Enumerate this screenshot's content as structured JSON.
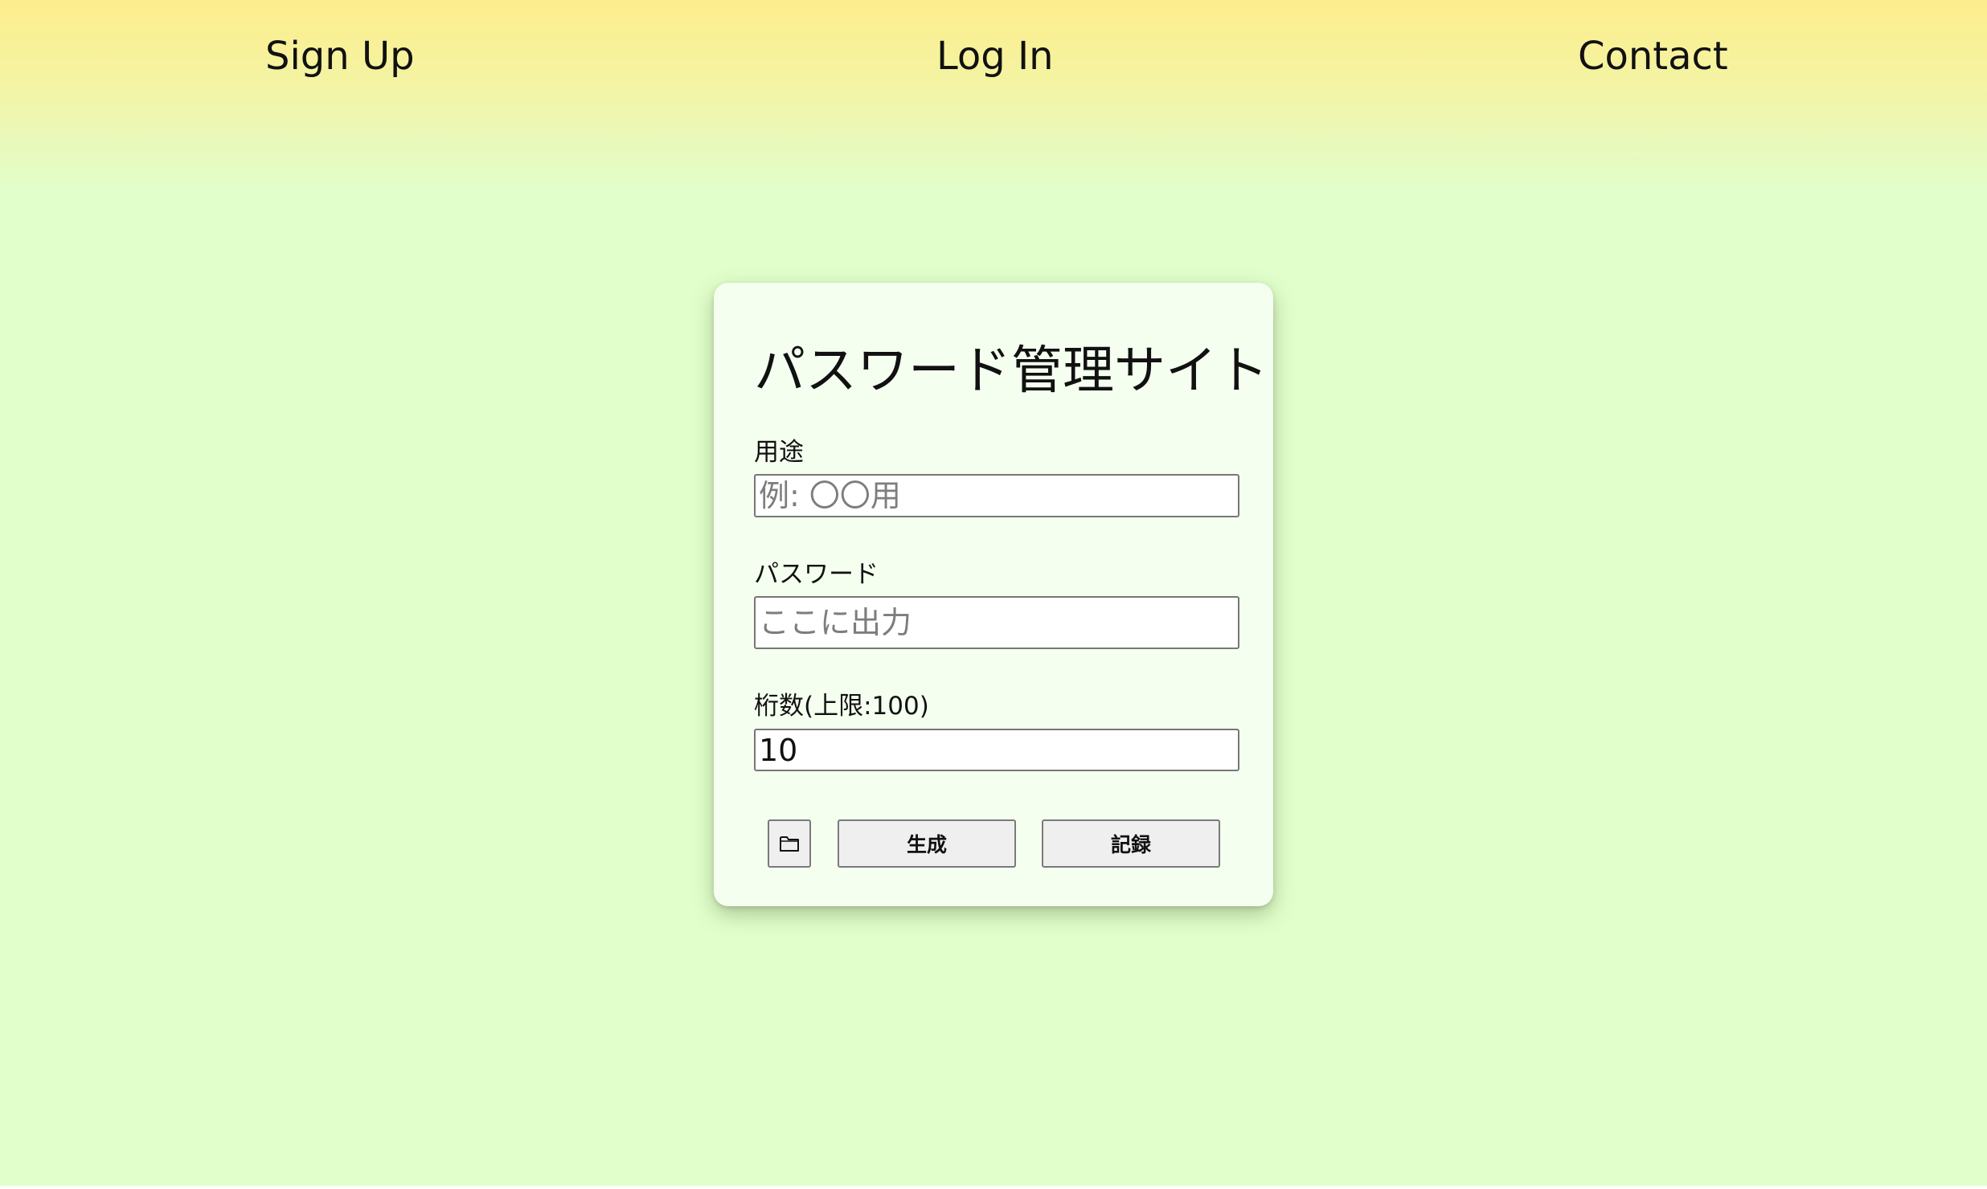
{
  "nav": {
    "items": [
      {
        "label": "Sign Up"
      },
      {
        "label": "Log In"
      },
      {
        "label": "Contact"
      }
    ]
  },
  "card": {
    "title": "パスワード管理サイト",
    "usage": {
      "label": "用途",
      "value": "",
      "placeholder": "例: 〇〇用"
    },
    "password": {
      "label": "パスワード",
      "value": "",
      "placeholder": "ここに出力"
    },
    "digits": {
      "label": "桁数(上限:100)",
      "value": "10"
    },
    "buttons": {
      "folder_icon": "folder-icon",
      "generate_label": "生成",
      "record_label": "記録"
    }
  },
  "colors": {
    "page_background": "#e1ffcb",
    "header_top": "#fdee8c",
    "card_background": "#f5fff0",
    "button_background": "#efefef"
  }
}
